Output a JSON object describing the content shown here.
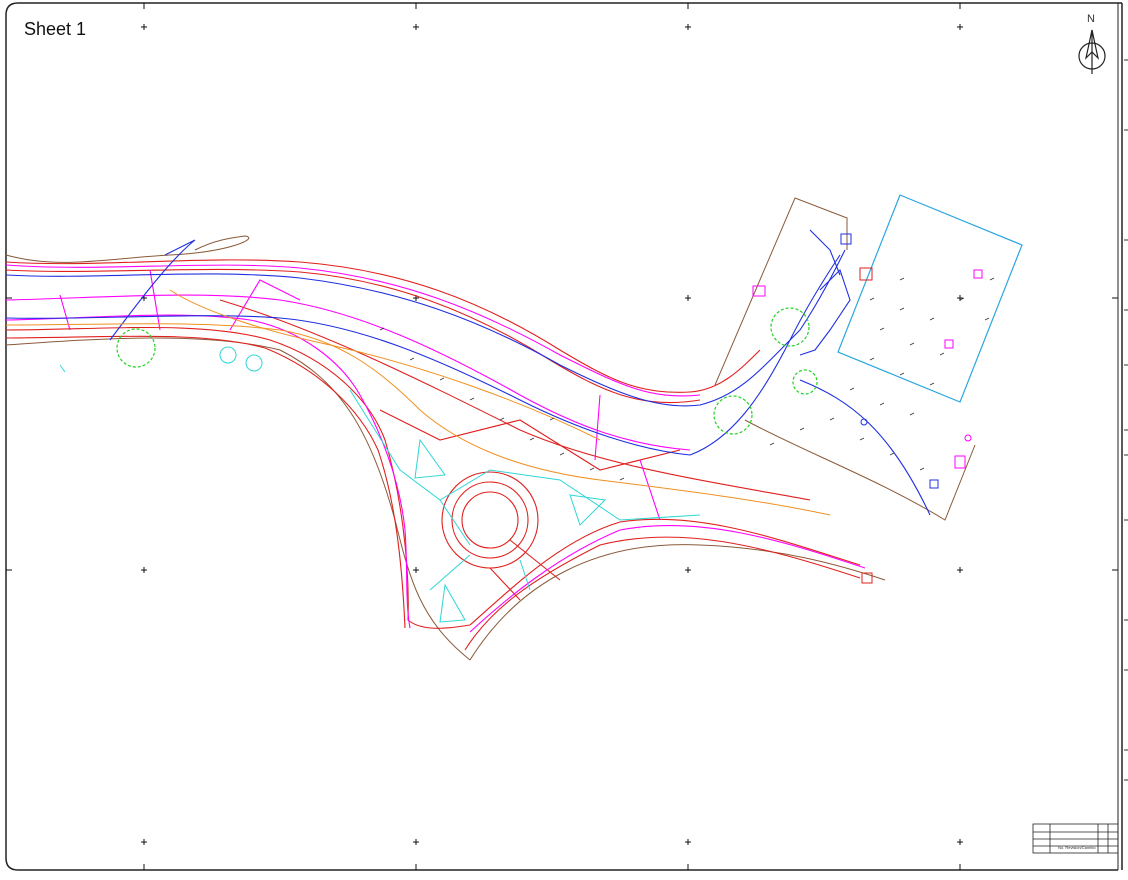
{
  "sheet": {
    "title": "Sheet 1"
  },
  "north_arrow": {
    "label": "N"
  },
  "title_block": {
    "label": "No. Revisión/Cambio"
  },
  "colors": {
    "red": "#e0201e",
    "magenta": "#ff00ff",
    "blue": "#1f2fe0",
    "brown": "#8a5a3a",
    "cyan": "#2fd6d6",
    "green": "#22d122",
    "orange": "#f09020",
    "lightblue": "#2aa6e0"
  }
}
